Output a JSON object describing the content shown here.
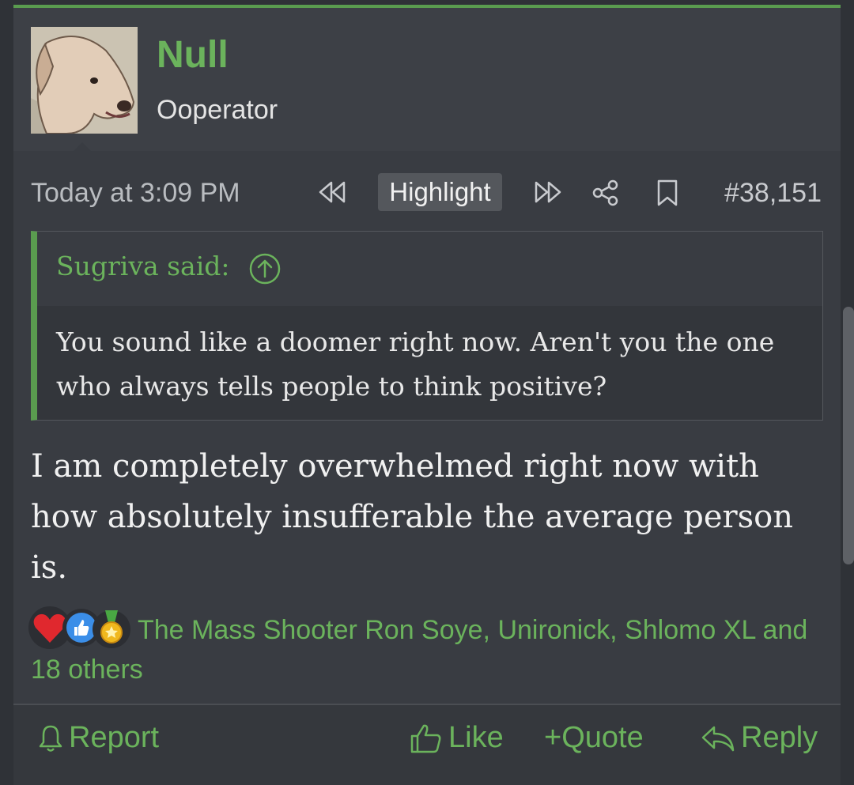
{
  "user": {
    "name": "Null",
    "title": "Ooperator"
  },
  "meta": {
    "timestamp": "Today at 3:09 PM",
    "highlight_label": "Highlight",
    "post_number": "#38,151"
  },
  "quote": {
    "author": "Sugriva said:",
    "text": "You sound like a doomer right now. Aren't you the one who always tells people to think positive?"
  },
  "message": "I am completely overwhelmed right now with how absolutely insufferable the average person is.",
  "reactions": {
    "icons": [
      "heart-icon",
      "thumbs-up-icon",
      "medal-icon"
    ],
    "names": "The Mass Shooter Ron Soye, Unironick, Shlomo XL and 18 others"
  },
  "footer": {
    "report": "Report",
    "like": "Like",
    "quote": "+Quote",
    "reply": "Reply"
  },
  "colors": {
    "accent": "#6bb35c",
    "background": "#393c42",
    "text": "#f0f0f0"
  }
}
